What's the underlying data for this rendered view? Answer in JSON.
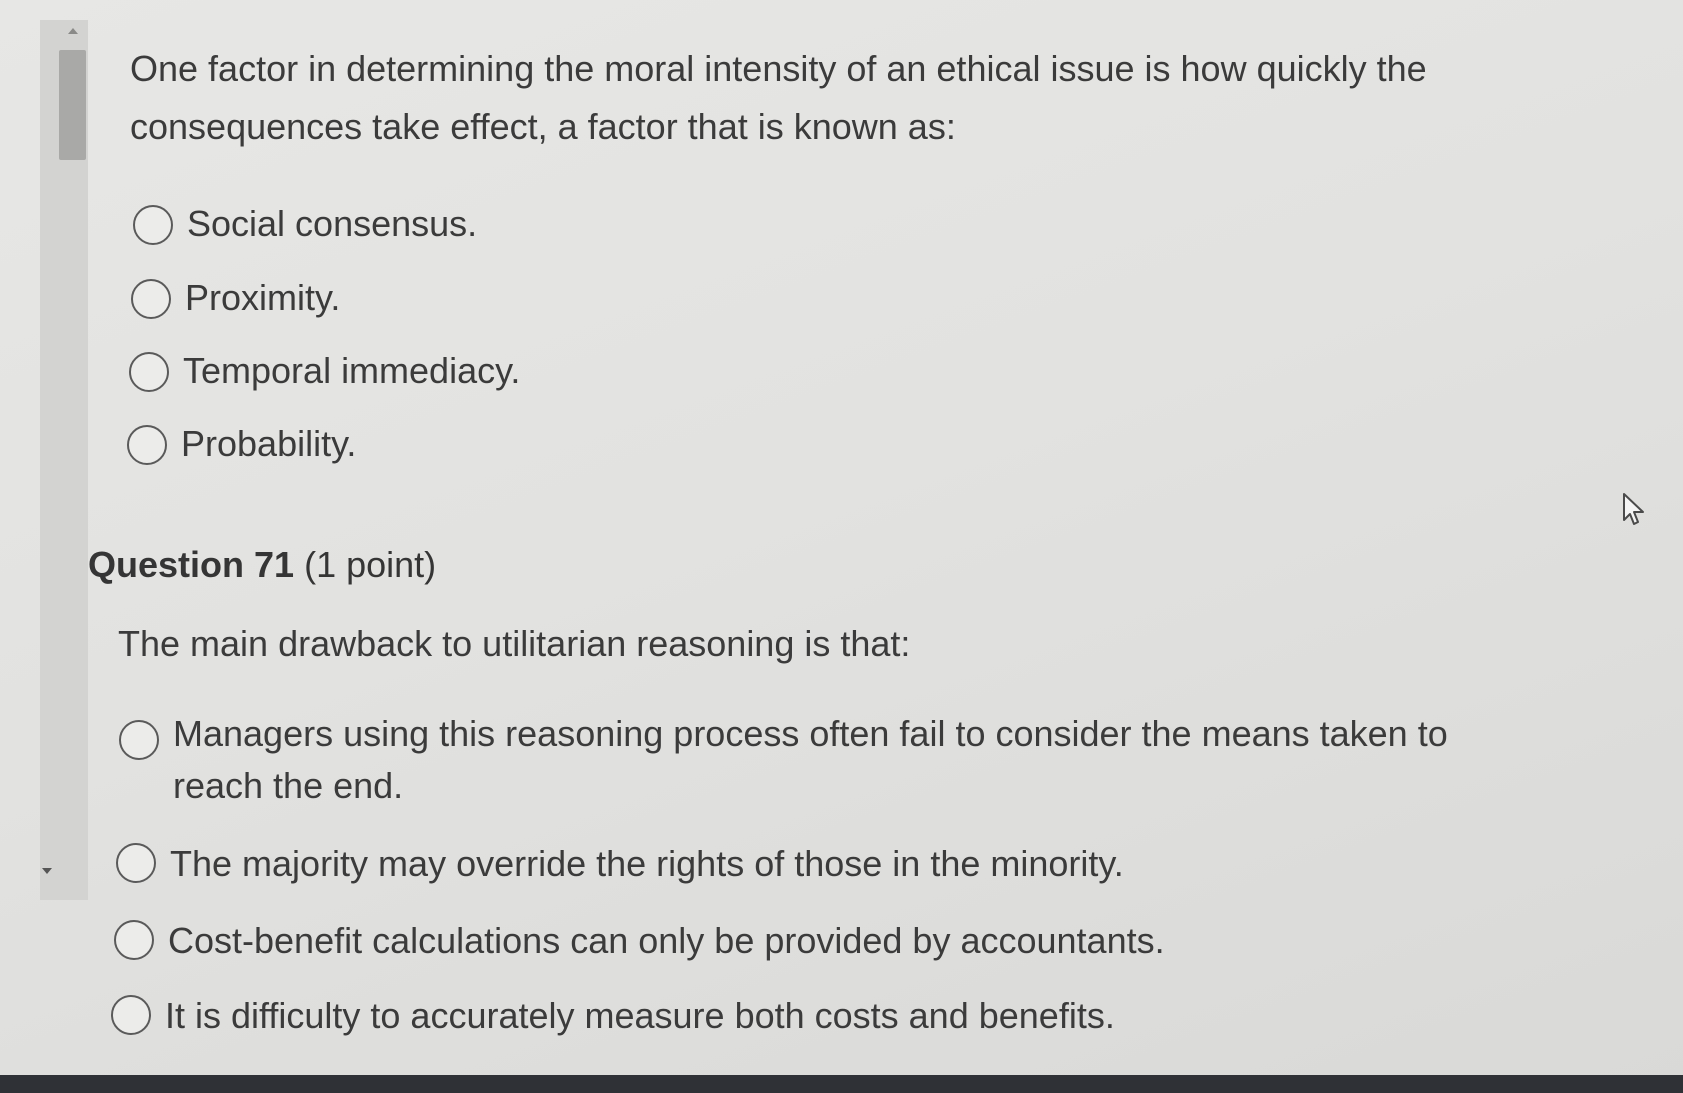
{
  "previous_question": {
    "text": "One factor in determining the moral intensity of an ethical issue is how quickly the consequences take effect, a factor that is known as:",
    "options": [
      "Social consensus.",
      "Proximity.",
      "Temporal immediacy.",
      "Probability."
    ]
  },
  "question": {
    "number_label": "Question 71",
    "points_label": "(1 point)",
    "text": "The main drawback to utilitarian reasoning is that:",
    "options": [
      "Managers using this reasoning process often fail to consider the means taken to reach the end.",
      "The majority may override the rights of those in the minority.",
      "Cost-benefit calculations can only be provided by accountants.",
      "It is difficulty to accurately measure both costs and benefits."
    ]
  },
  "icons": {
    "scroll_up": "chevron-up-icon",
    "scroll_down": "chevron-down-icon",
    "cursor": "mouse-pointer-icon"
  }
}
